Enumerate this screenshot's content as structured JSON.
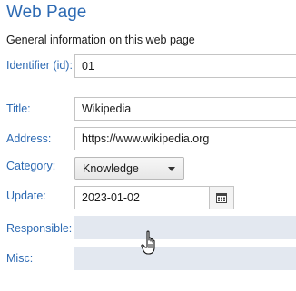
{
  "header": {
    "title": "Web Page",
    "subtitle": "General information on this web page"
  },
  "fields": {
    "identifier": {
      "label": "Identifier (id):",
      "value": "01"
    },
    "title": {
      "label": "Title:",
      "value": "Wikipedia"
    },
    "address": {
      "label": "Address:",
      "value": "https://www.wikipedia.org"
    },
    "category": {
      "label": "Category:",
      "value": "Knowledge"
    },
    "update": {
      "label": "Update:",
      "value": "2023-01-02"
    },
    "responsible": {
      "label": "Responsible:",
      "value": ""
    },
    "misc": {
      "label": "Misc:",
      "value": ""
    }
  },
  "icons": {
    "calendar": "calendar-icon",
    "dropdown": "chevron-down-icon",
    "cursor": "hand-pointer-icon"
  },
  "colors": {
    "accent": "#2d6ab3",
    "empty_field_bg": "#e3e8f0",
    "border": "#c4c4c4"
  }
}
